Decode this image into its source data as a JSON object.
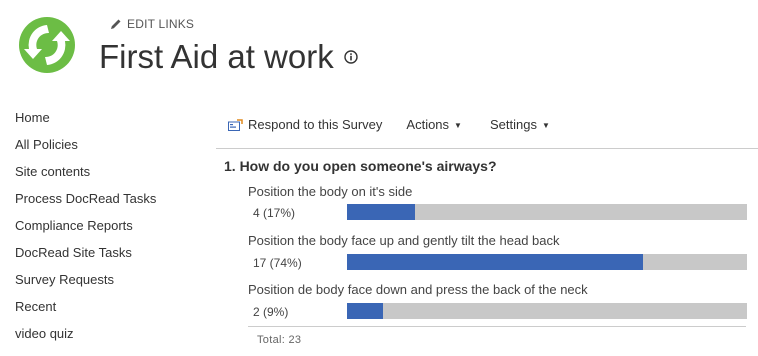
{
  "header": {
    "edit_links": "EDIT LINKS",
    "site_title": "First Aid at work"
  },
  "nav": {
    "items": [
      {
        "label": "Home"
      },
      {
        "label": "All Policies"
      },
      {
        "label": "Site contents"
      },
      {
        "label": "Process DocRead Tasks"
      },
      {
        "label": "Compliance Reports"
      },
      {
        "label": "DocRead Site Tasks"
      },
      {
        "label": "Survey Requests"
      },
      {
        "label": "Recent"
      },
      {
        "label": "video quiz"
      }
    ]
  },
  "toolbar": {
    "respond_label": "Respond to this Survey",
    "actions_label": "Actions",
    "settings_label": "Settings"
  },
  "survey": {
    "question": "1. How do you open someone's airways?",
    "answers": [
      {
        "label": "Position the body on it's side",
        "count_text": "4 (17%)",
        "fraction": 0.17
      },
      {
        "label": "Position the body face up and gently tilt the head back",
        "count_text": "17 (74%)",
        "fraction": 0.74
      },
      {
        "label": "Position de body face down and press the back of the neck",
        "count_text": "2 (9%)",
        "fraction": 0.09
      }
    ],
    "total_text": "Total: 23"
  },
  "colors": {
    "bar_fill": "#3a66b5",
    "bar_track": "#c8c8c8",
    "logo_green": "#6cbd45"
  }
}
